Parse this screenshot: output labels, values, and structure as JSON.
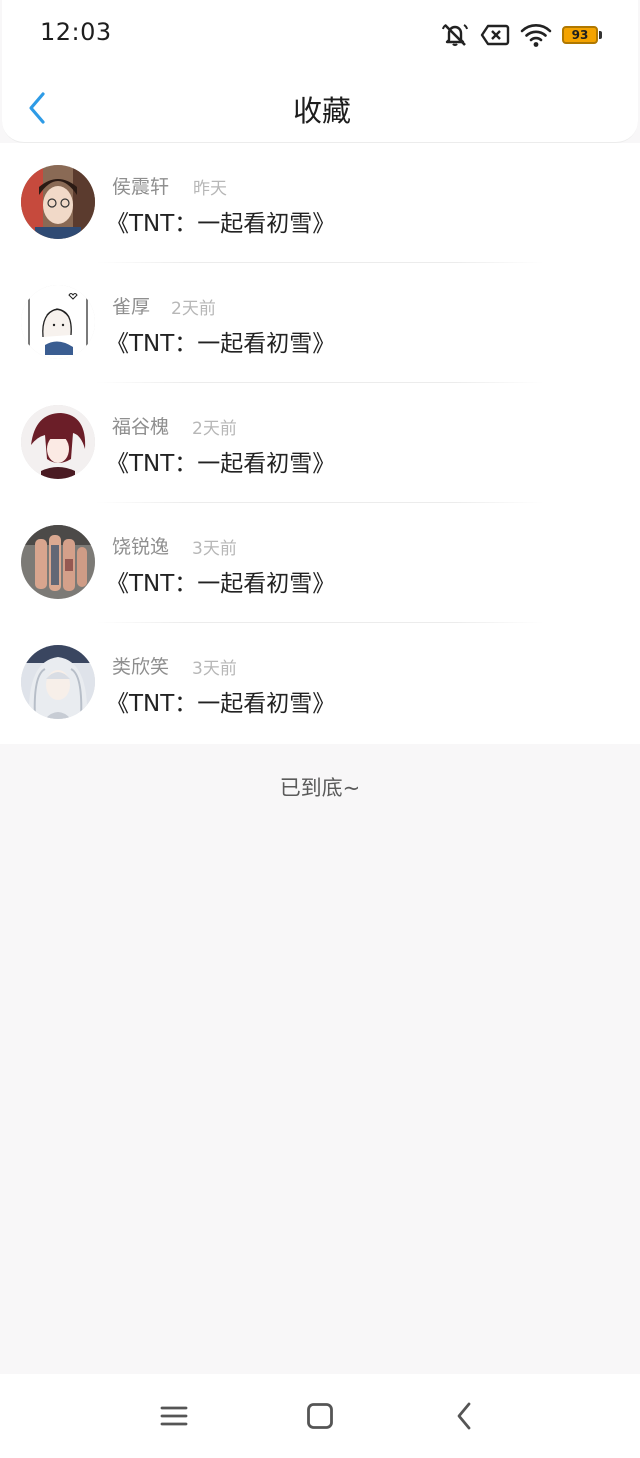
{
  "status_bar": {
    "time": "12:03",
    "icons": [
      "mute-icon",
      "no-sim-icon",
      "wifi-icon"
    ],
    "battery": "93",
    "battery_color": "#f4a300"
  },
  "title_bar": {
    "back_icon": "chevron-left-icon",
    "title": "收藏",
    "accent_color": "#2e9be6"
  },
  "favorites": [
    {
      "name": "侯震轩",
      "time": "昨天",
      "content": "《TNT：一起看初雪》"
    },
    {
      "name": "雀厚",
      "time": "2天前",
      "content": "《TNT：一起看初雪》"
    },
    {
      "name": "福谷槐",
      "time": "2天前",
      "content": "《TNT：一起看初雪》"
    },
    {
      "name": "饶锐逸",
      "time": "3天前",
      "content": "《TNT：一起看初雪》"
    },
    {
      "name": "类欣笑",
      "time": "3天前",
      "content": "《TNT：一起看初雪》"
    }
  ],
  "end_text": "已到底~",
  "nav_bar": {
    "buttons": [
      "menu-icon",
      "home-icon",
      "back-icon"
    ]
  }
}
